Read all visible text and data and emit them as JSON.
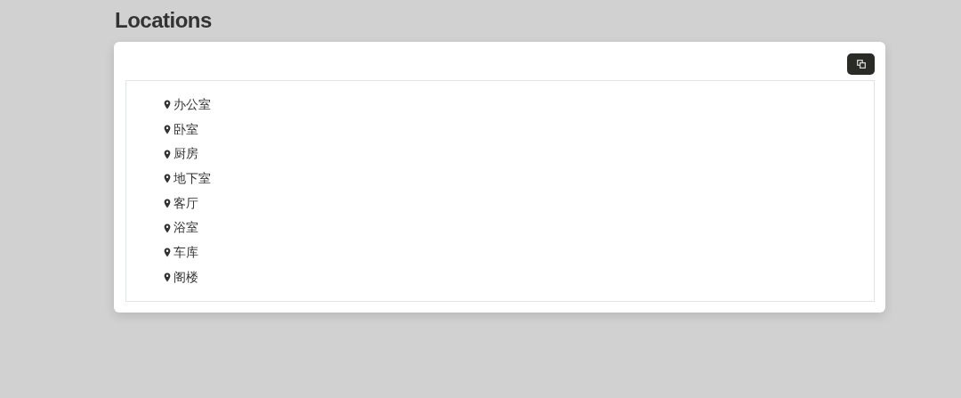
{
  "title": "Locations",
  "locations": [
    {
      "name": "办公室"
    },
    {
      "name": "卧室"
    },
    {
      "name": "厨房"
    },
    {
      "name": "地下室"
    },
    {
      "name": "客厅"
    },
    {
      "name": "浴室"
    },
    {
      "name": "车库"
    },
    {
      "name": "阁楼"
    }
  ]
}
